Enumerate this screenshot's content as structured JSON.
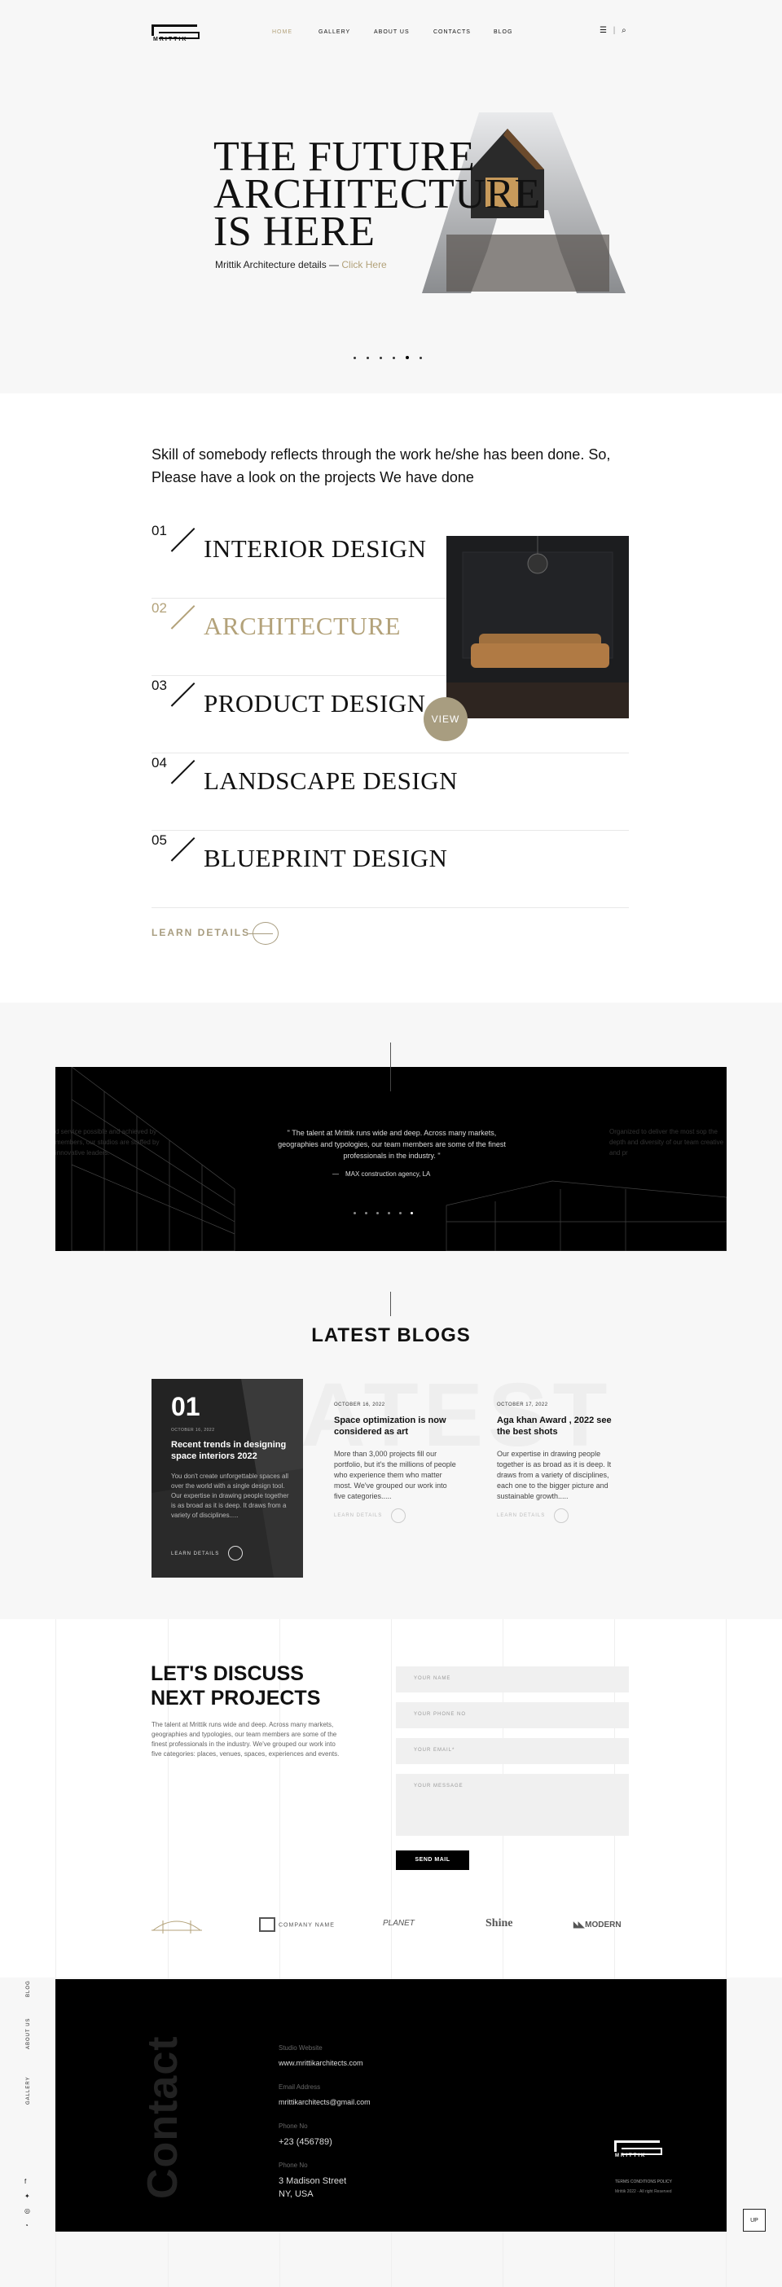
{
  "header": {
    "logo_text": "MRITTIK",
    "nav": [
      "HOME",
      "GALLERY",
      "ABOUT US",
      "CONTACTS",
      "BLOG"
    ],
    "icons": [
      "menu-icon",
      "search-icon"
    ]
  },
  "hero": {
    "title_1": "THE FUTURE",
    "title_2": "ARCHITECTURE",
    "title_3": "IS HERE",
    "subtitle": "Mrittik Architecture details —",
    "link": "Click Here",
    "big_letter": "A"
  },
  "services": {
    "intro": "Skill of somebody reflects through the work he/she has been done. So, Please have a look on the projects We have done",
    "items": [
      {
        "num": "01",
        "name": "INTERIOR DESIGN"
      },
      {
        "num": "02",
        "name": "ARCHITECTURE"
      },
      {
        "num": "03",
        "name": "PRODUCT DESIGN"
      },
      {
        "num": "04",
        "name": "LANDSCAPE DESIGN"
      },
      {
        "num": "05",
        "name": "BLUEPRINT DESIGN"
      }
    ],
    "view": "VIEW",
    "learn": "LEARN DETAILS"
  },
  "testimonial": {
    "quote": "\" The talent at Mrittik runs wide and deep. Across many markets, geographies and typologies, our team members are some of the finest professionals in the industry. \"",
    "author": "MAX construction agency, LA",
    "left": "d service possible and achieved by members, our studios are staffed by innovative leaders.",
    "right": "Organized to deliver the most sop the depth and diversity of our team creative and pr"
  },
  "blogs": {
    "title": "LATEST BLOGS",
    "bg": "LATEST",
    "featured": {
      "num": "01",
      "date": "OCTOBER 16, 2022",
      "title": "Recent trends in designing space interiors 2022",
      "text": "You don't create unforgettable spaces all over the world with a single design tool. Our expertise in drawing people together is as broad as it is deep. It draws from a variety of disciplines.....",
      "link": "LEARN DETAILS"
    },
    "posts": [
      {
        "date": "OCTOBER 16, 2022",
        "title": "Space optimization is now considered as art",
        "text": "More than 3,000 projects fill our portfolio, but it's the millions of people who experience them who matter most. We've grouped our work into five categories.....",
        "link": "LEARN DETAILS"
      },
      {
        "date": "OCTOBER 17, 2022",
        "title": "Aga khan Award , 2022 see the best shots",
        "text": "Our expertise in drawing people together is as broad as it is deep. It draws from a variety of disciplines, each one to the bigger picture and sustainable growth.....",
        "link": "LEARN DETAILS"
      }
    ]
  },
  "discuss": {
    "title_1": "LET'S DISCUSS",
    "title_2": "NEXT PROJECTS",
    "text": "The talent at Mrittik runs wide and deep. Across many markets, geographies and typologies, our team members are some of the finest professionals in the industry. We've grouped our work into five categories: places, venues, spaces, experiences and events.",
    "fields": [
      "YOUR NAME",
      "YOUR PHONE NO",
      "YOUR EMAIL*",
      "YOUR MESSAGE"
    ],
    "send": "SEND MAIL"
  },
  "brands": [
    "COMPANY NAME",
    "PLANET",
    "Shine",
    "MODERN"
  ],
  "footer": {
    "contact": "Contact",
    "website_label": "Studio Website",
    "website": "www.mrittikarchitects.com",
    "email_label": "Email Address",
    "email": "mrittikarchitects@gmail.com",
    "phone_label": "Phone No",
    "phone": "+23 (456789)",
    "address_label": "Phone No",
    "address_1": "3 Madison Street",
    "address_2": "NY, USA",
    "logo": "MRITTIK",
    "links": "TERMS      CONDITIONS      POLICY",
    "copy": "Mrittik 2022 - All right Reserved",
    "up": "UP",
    "side": [
      "BLOG",
      "ABOUT US",
      "GALLERY"
    ]
  }
}
